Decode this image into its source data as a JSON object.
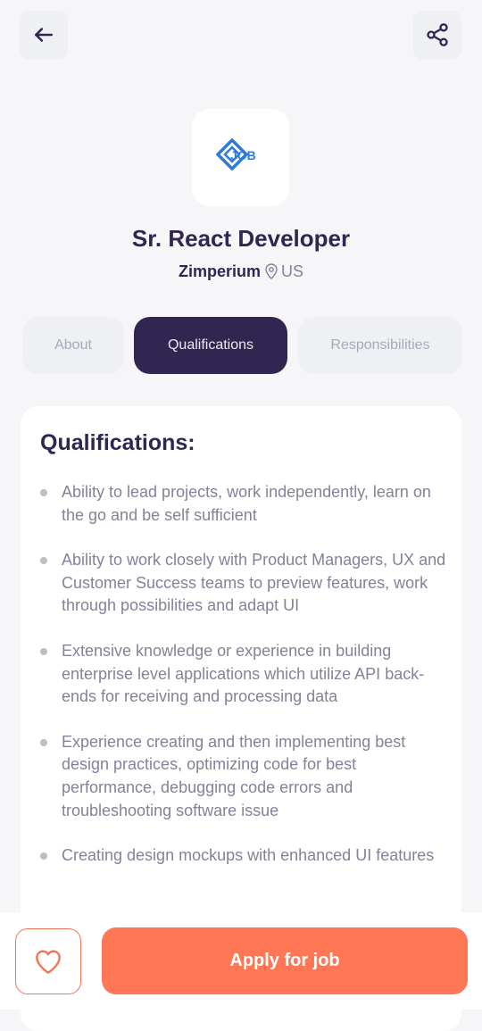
{
  "header": {
    "back_icon": "arrow-left-icon",
    "share_icon": "share-icon"
  },
  "job": {
    "logo_text": "JOB",
    "title": "Sr. React Developer",
    "company": "Zimperium",
    "location_icon": "location-pin-icon",
    "location": "US"
  },
  "tabs": [
    {
      "label": "About",
      "active": false
    },
    {
      "label": "Qualifications",
      "active": true
    },
    {
      "label": "Responsibilities",
      "active": false
    }
  ],
  "qualifications": {
    "title": "Qualifications:",
    "points": [
      "Ability to lead projects, work independently, learn on the go and be self sufficient",
      "Ability to work closely with Product Managers, UX and Customer Success teams to preview features, work through possibilities and adapt UI",
      "Extensive knowledge or experience in building enterprise level applications which utilize API back-ends for receiving and processing data",
      "Experience creating and then implementing best design practices, optimizing code for best performance, debugging code errors and troubleshooting software issue",
      "Creating design mockups with enhanced UI features"
    ]
  },
  "footer": {
    "like_icon": "heart-icon",
    "apply_label": "Apply for job"
  },
  "colors": {
    "primary": "#312651",
    "accent": "#FF7754",
    "gray": "#83829A",
    "background": "#F6F6F8",
    "tab_inactive": "#EEF0F4"
  }
}
